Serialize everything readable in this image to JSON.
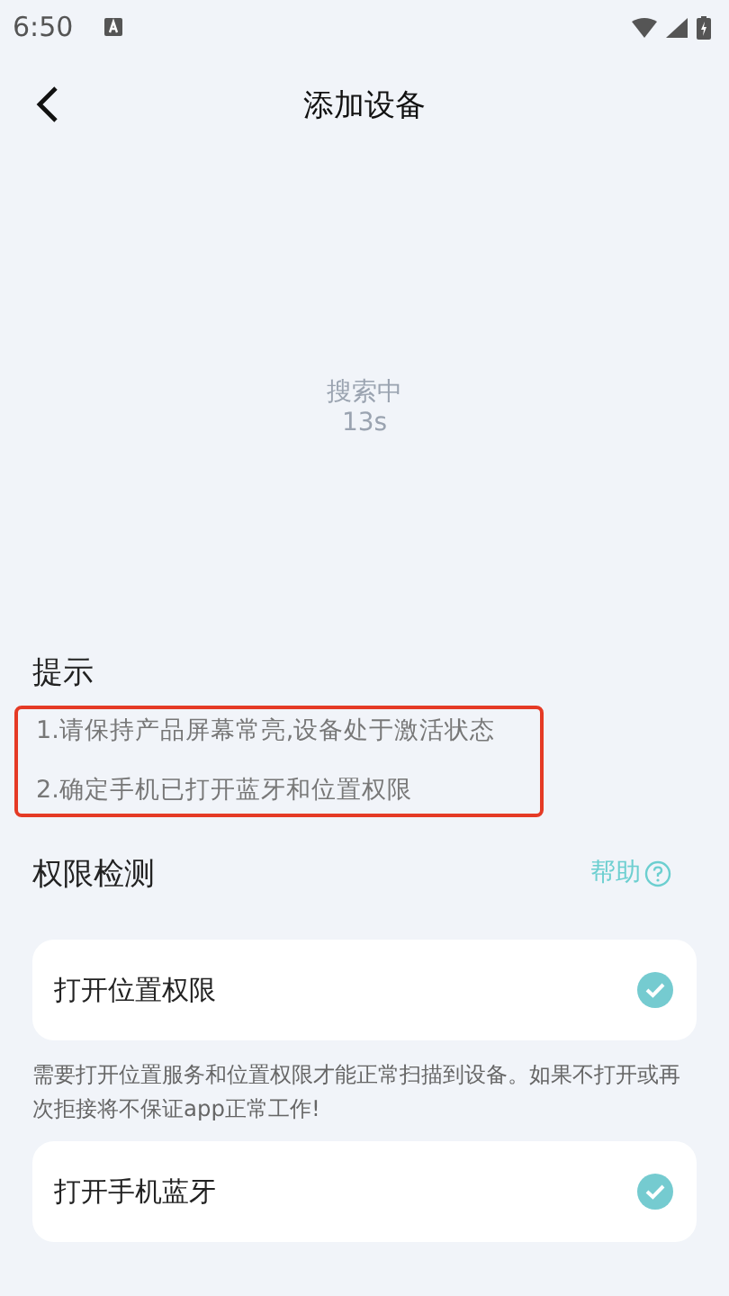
{
  "status_bar": {
    "time": "6:50"
  },
  "header": {
    "title": "添加设备"
  },
  "searching": {
    "label": "搜索中",
    "countdown": "13s"
  },
  "tips": {
    "title": "提示",
    "highlighted": true,
    "items": [
      "1.请保持产品屏幕常亮,设备处于激活状态",
      "2.确定手机已打开蓝牙和位置权限"
    ]
  },
  "permissions": {
    "title": "权限检测",
    "help": "帮助",
    "items": [
      {
        "label": "打开位置权限",
        "checked": true,
        "note": "需要打开位置服务和位置权限才能正常扫描到设备。如果不打开或再次拒接将不保证app正常工作!"
      },
      {
        "label": "打开手机蓝牙",
        "checked": true
      }
    ]
  }
}
